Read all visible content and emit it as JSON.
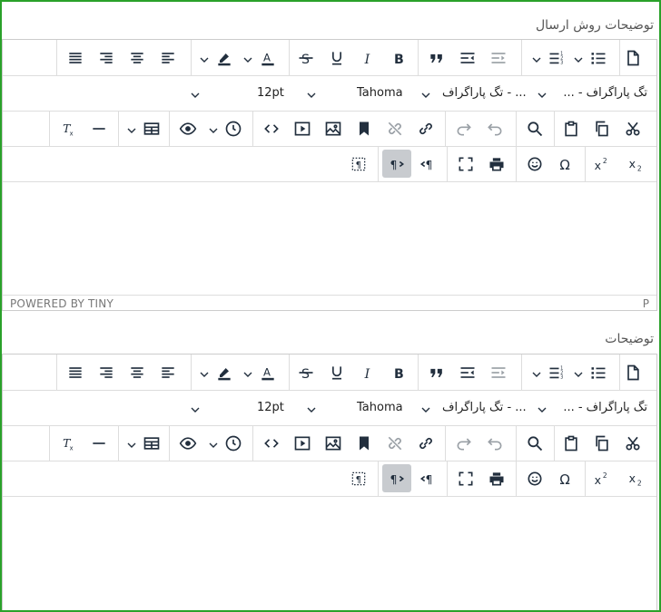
{
  "colors": {
    "frame": "#2aa12a",
    "icon": "#222f3e",
    "active": "#c8cbcf"
  },
  "editors": [
    {
      "label": "توضیحات روش ارسال",
      "font_size": "12pt",
      "font_family": "Tahoma",
      "paragraph": "تگ پاراگراف - ...",
      "status_left": "POWERED BY TINY",
      "status_right": "P"
    },
    {
      "label": "توضیحات",
      "font_size": "12pt",
      "font_family": "Tahoma",
      "paragraph": "تگ پاراگراف - ..."
    }
  ]
}
